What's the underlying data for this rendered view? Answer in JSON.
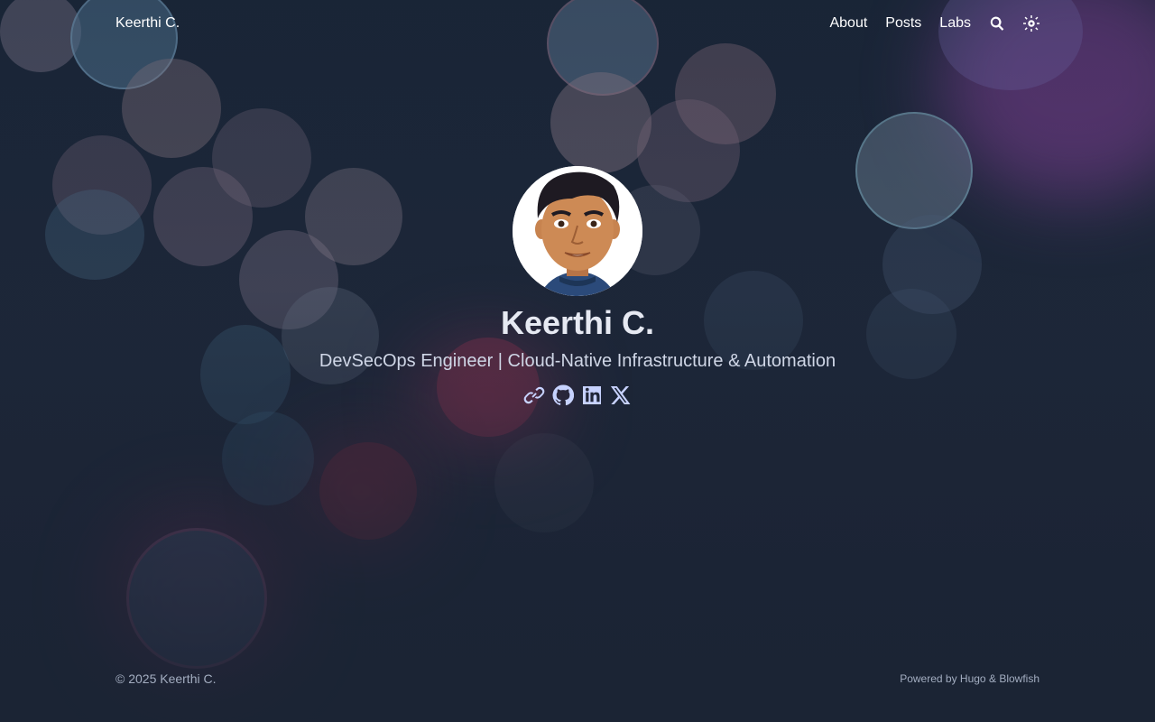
{
  "header": {
    "site_title": "Keerthi C.",
    "nav": [
      {
        "label": "About"
      },
      {
        "label": "Posts"
      },
      {
        "label": "Labs"
      }
    ],
    "search_icon": "search-icon",
    "theme_icon": "sun-icon"
  },
  "hero": {
    "name": "Keerthi C.",
    "tagline": "DevSecOps Engineer | Cloud-Native Infrastructure & Automation",
    "social": [
      {
        "icon": "link-icon"
      },
      {
        "icon": "github-icon"
      },
      {
        "icon": "linkedin-icon"
      },
      {
        "icon": "x-twitter-icon"
      }
    ]
  },
  "footer": {
    "copyright": "© 2025 Keerthi C.",
    "powered_prefix": "Powered by",
    "hugo": "Hugo",
    "amp": "&",
    "blowfish": "Blowfish"
  },
  "colors": {
    "background": "#1b2637",
    "text": "#ffffff",
    "accent": "#c7d2fe",
    "muted": "#a3adc0"
  }
}
